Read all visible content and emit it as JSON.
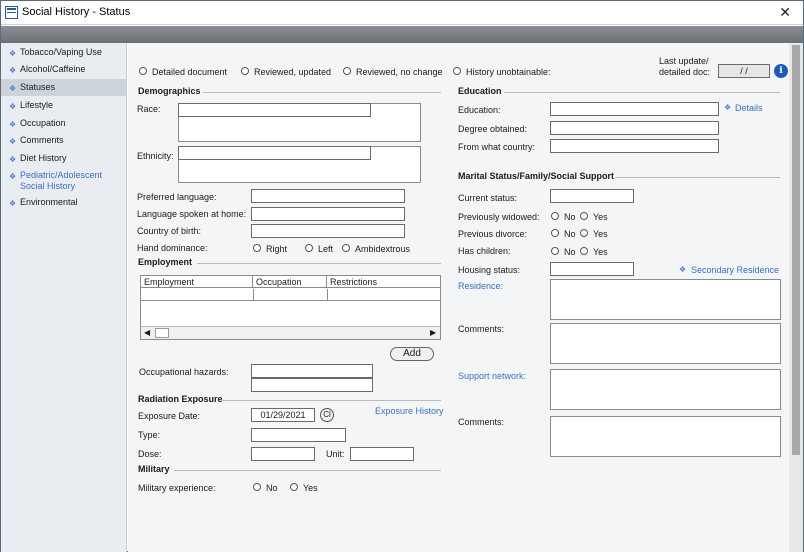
{
  "window": {
    "title": "Social History - Status",
    "close_glyph": "✕"
  },
  "sidebar": {
    "items": [
      {
        "label": "Tobacco/Vaping Use"
      },
      {
        "label": "Alcohol/Caffeine"
      },
      {
        "label": "Statuses"
      },
      {
        "label": "Lifestyle"
      },
      {
        "label": "Occupation"
      },
      {
        "label": "Comments"
      },
      {
        "label": "Diet History"
      },
      {
        "label": "Pediatric/Adolescent Social History"
      },
      {
        "label": "Environmental"
      }
    ],
    "active_index": 2
  },
  "review": {
    "options": [
      "Detailed document",
      "Reviewed, updated",
      "Reviewed, no change",
      "History unobtainable:"
    ],
    "last_update_label_1": "Last update/",
    "last_update_label_2": "detailed doc:",
    "last_update_value": " / /"
  },
  "demographics": {
    "header": "Demographics",
    "race_label": "Race:",
    "ethnicity_label": "Ethnicity:",
    "preferred_language_label": "Preferred language:",
    "language_home_label": "Language spoken at home:",
    "country_birth_label": "Country of birth:",
    "hand_dominance_label": "Hand dominance:",
    "hand_options": [
      "Right",
      "Left",
      "Ambidextrous"
    ]
  },
  "employment": {
    "header": "Employment",
    "columns": [
      "Employment",
      "Occupation",
      "Restrictions"
    ],
    "add_label": "Add",
    "hazards_label": "Occupational hazards:"
  },
  "radiation": {
    "header": "Radiation Exposure",
    "date_label": "Exposure Date:",
    "date_value": "01/29/2021",
    "clear_glyph": "Cl",
    "history_link": "Exposure History",
    "type_label": "Type:",
    "dose_label": "Dose:",
    "unit_label": "Unit:"
  },
  "military": {
    "header": "Military",
    "experience_label": "Military experience:",
    "options": [
      "No",
      "Yes"
    ]
  },
  "education": {
    "header": "Education",
    "education_label": "Education:",
    "details_link": "Details",
    "degree_label": "Degree obtained:",
    "country_label": "From what country:"
  },
  "marital": {
    "header": "Marital Status/Family/Social Support",
    "current_status_label": "Current status:",
    "prev_widowed_label": "Previously widowed:",
    "prev_divorce_label": "Previous divorce:",
    "has_children_label": "Has children:",
    "no_label": "No",
    "yes_label": "Yes",
    "housing_label": "Housing status:",
    "secondary_residence_link": "Secondary Residence",
    "residence_link": "Residence:",
    "comments_label": "Comments:",
    "support_network_link": "Support network:",
    "comments2_label": "Comments:"
  },
  "icons": {
    "info": "i",
    "diamond": "❖"
  }
}
